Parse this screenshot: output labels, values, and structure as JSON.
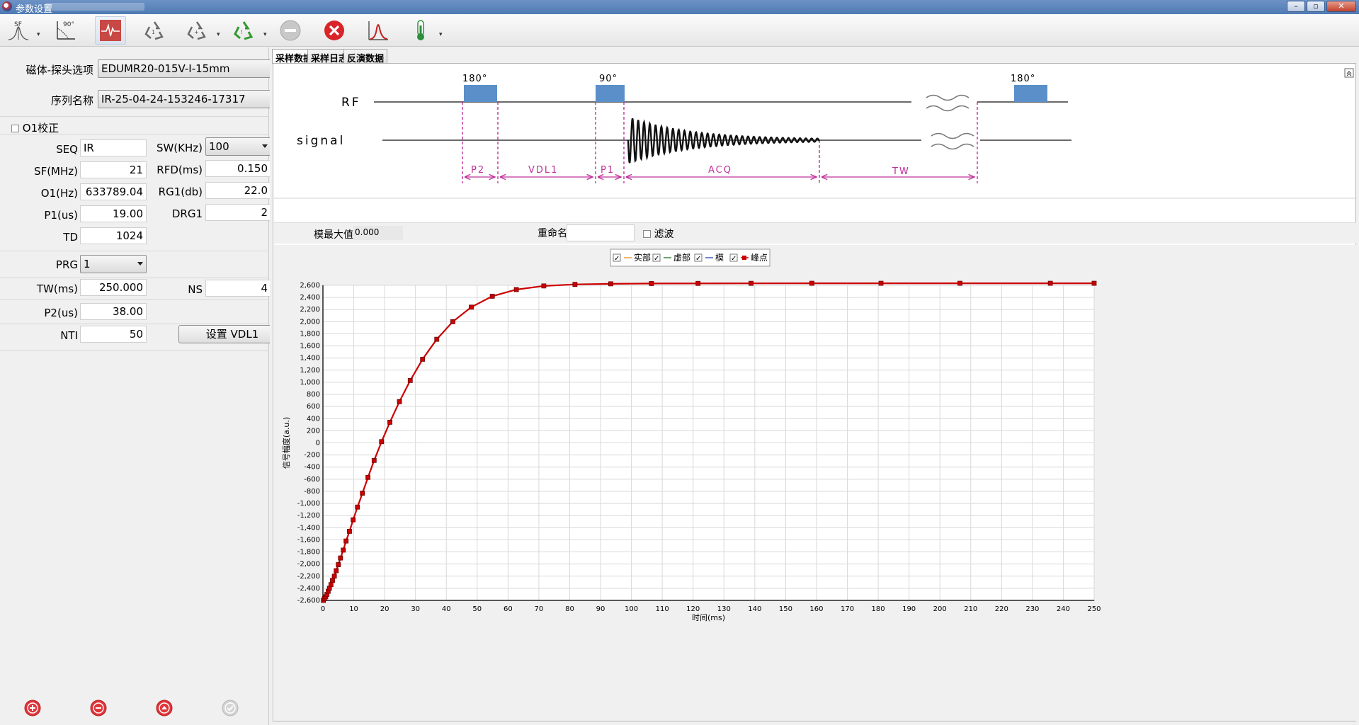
{
  "window": {
    "title": "参数设置"
  },
  "toolbar": {
    "icons": [
      "sf-pulse-icon",
      "flip-90-icon",
      "waveform-icon",
      "recycle-icon",
      "recycle-dropdown-icon",
      "recycle-green-icon",
      "stop-icon",
      "close-icon",
      "peak-icon",
      "thermometer-icon"
    ],
    "sf_label": "SF",
    "angle_label": "90°"
  },
  "params": {
    "magnet_probe_label": "磁体-探头选项",
    "magnet_probe_value": "EDUMR20-015V-I-15mm",
    "sequence_name_label": "序列名称",
    "sequence_name_value": "IR-25-04-24-153246-17317",
    "o1_correction_label": "O1校正",
    "seq_label": "SEQ",
    "seq_value": "IR",
    "sw_label": "SW(KHz)",
    "sw_value": "100",
    "sf_label": "SF(MHz)",
    "sf_value": "21",
    "rfd_label": "RFD(ms)",
    "rfd_value": "0.150",
    "o1_label": "O1(Hz)",
    "o1_value": "633789.04",
    "rg1_label": "RG1(db)",
    "rg1_value": "22.0",
    "p1_label": "P1(us)",
    "p1_value": "19.00",
    "drg1_label": "DRG1",
    "drg1_value": "2",
    "td_label": "TD",
    "td_value": "1024",
    "prg_label": "PRG",
    "prg_value": "1",
    "tw_label": "TW(ms)",
    "tw_value": "250.000",
    "ns_label": "NS",
    "ns_value": "4",
    "p2_label": "P2(us)",
    "p2_value": "38.00",
    "nti_label": "NTI",
    "nti_value": "50",
    "set_vdl1_label": "设置 VDL1"
  },
  "tabs": [
    {
      "label": "采样数据",
      "active": true
    },
    {
      "label": "采样日志",
      "active": false
    },
    {
      "label": "反演数据",
      "active": false
    }
  ],
  "pulse_diagram": {
    "rf_label": "RF",
    "signal_label": "signal",
    "pulse_180_label": "180°",
    "pulse_90_label": "90°",
    "segments": [
      "P2",
      "VDL1",
      "P1",
      "ACQ",
      "TW"
    ]
  },
  "status": {
    "mod_max_label": "模最大值",
    "mod_max_value": "0.000",
    "rename_label": "重命名",
    "rename_value": "",
    "filter_label": "滤波"
  },
  "legend": [
    {
      "label": "实部",
      "color": "#e8a040",
      "checked": true
    },
    {
      "label": "虚部",
      "color": "#3a8a3a",
      "checked": true
    },
    {
      "label": "模",
      "color": "#4060c0",
      "checked": true
    },
    {
      "label": "峰点",
      "color": "#cc0000",
      "checked": true
    }
  ],
  "chart_data": {
    "type": "line",
    "xlabel": "时间(ms)",
    "ylabel": "信号幅度(a.u.)",
    "xlim": [
      0,
      250
    ],
    "ylim": [
      -2600,
      2600
    ],
    "xticks": [
      0,
      10,
      20,
      30,
      40,
      50,
      60,
      70,
      80,
      90,
      100,
      110,
      120,
      130,
      140,
      150,
      160,
      170,
      180,
      190,
      200,
      210,
      220,
      230,
      240,
      250
    ],
    "yticks": [
      -2600,
      -2400,
      -2200,
      -2000,
      -1800,
      -1600,
      -1400,
      -1200,
      -1000,
      -800,
      -600,
      -400,
      -200,
      0,
      200,
      400,
      600,
      800,
      1000,
      1200,
      1400,
      1600,
      1800,
      2000,
      2200,
      2400,
      2600
    ],
    "grid": true,
    "series": [
      {
        "name": "峰点",
        "color": "#cc0000",
        "x": [
          0.15,
          0.5,
          0.9,
          1.3,
          1.7,
          2.1,
          2.6,
          3.1,
          3.7,
          4.3,
          5.0,
          5.7,
          6.6,
          7.5,
          8.6,
          9.8,
          11.2,
          12.8,
          14.6,
          16.6,
          19.0,
          21.7,
          24.8,
          28.3,
          32.3,
          36.9,
          42.1,
          48.1,
          54.9,
          62.7,
          71.6,
          81.7,
          93.3,
          106.5,
          121.6,
          138.8,
          158.5,
          180.9,
          206.5,
          235.8,
          250.0
        ],
        "y": [
          -2600,
          -2570,
          -2540,
          -2500,
          -2450,
          -2400,
          -2340,
          -2270,
          -2200,
          -2110,
          -2010,
          -1900,
          -1770,
          -1620,
          -1460,
          -1270,
          -1060,
          -830,
          -570,
          -290,
          20,
          340,
          680,
          1030,
          1380,
          1710,
          2000,
          2240,
          2420,
          2530,
          2590,
          2615,
          2625,
          2630,
          2632,
          2633,
          2634,
          2634,
          2634,
          2634,
          2634
        ]
      }
    ]
  }
}
